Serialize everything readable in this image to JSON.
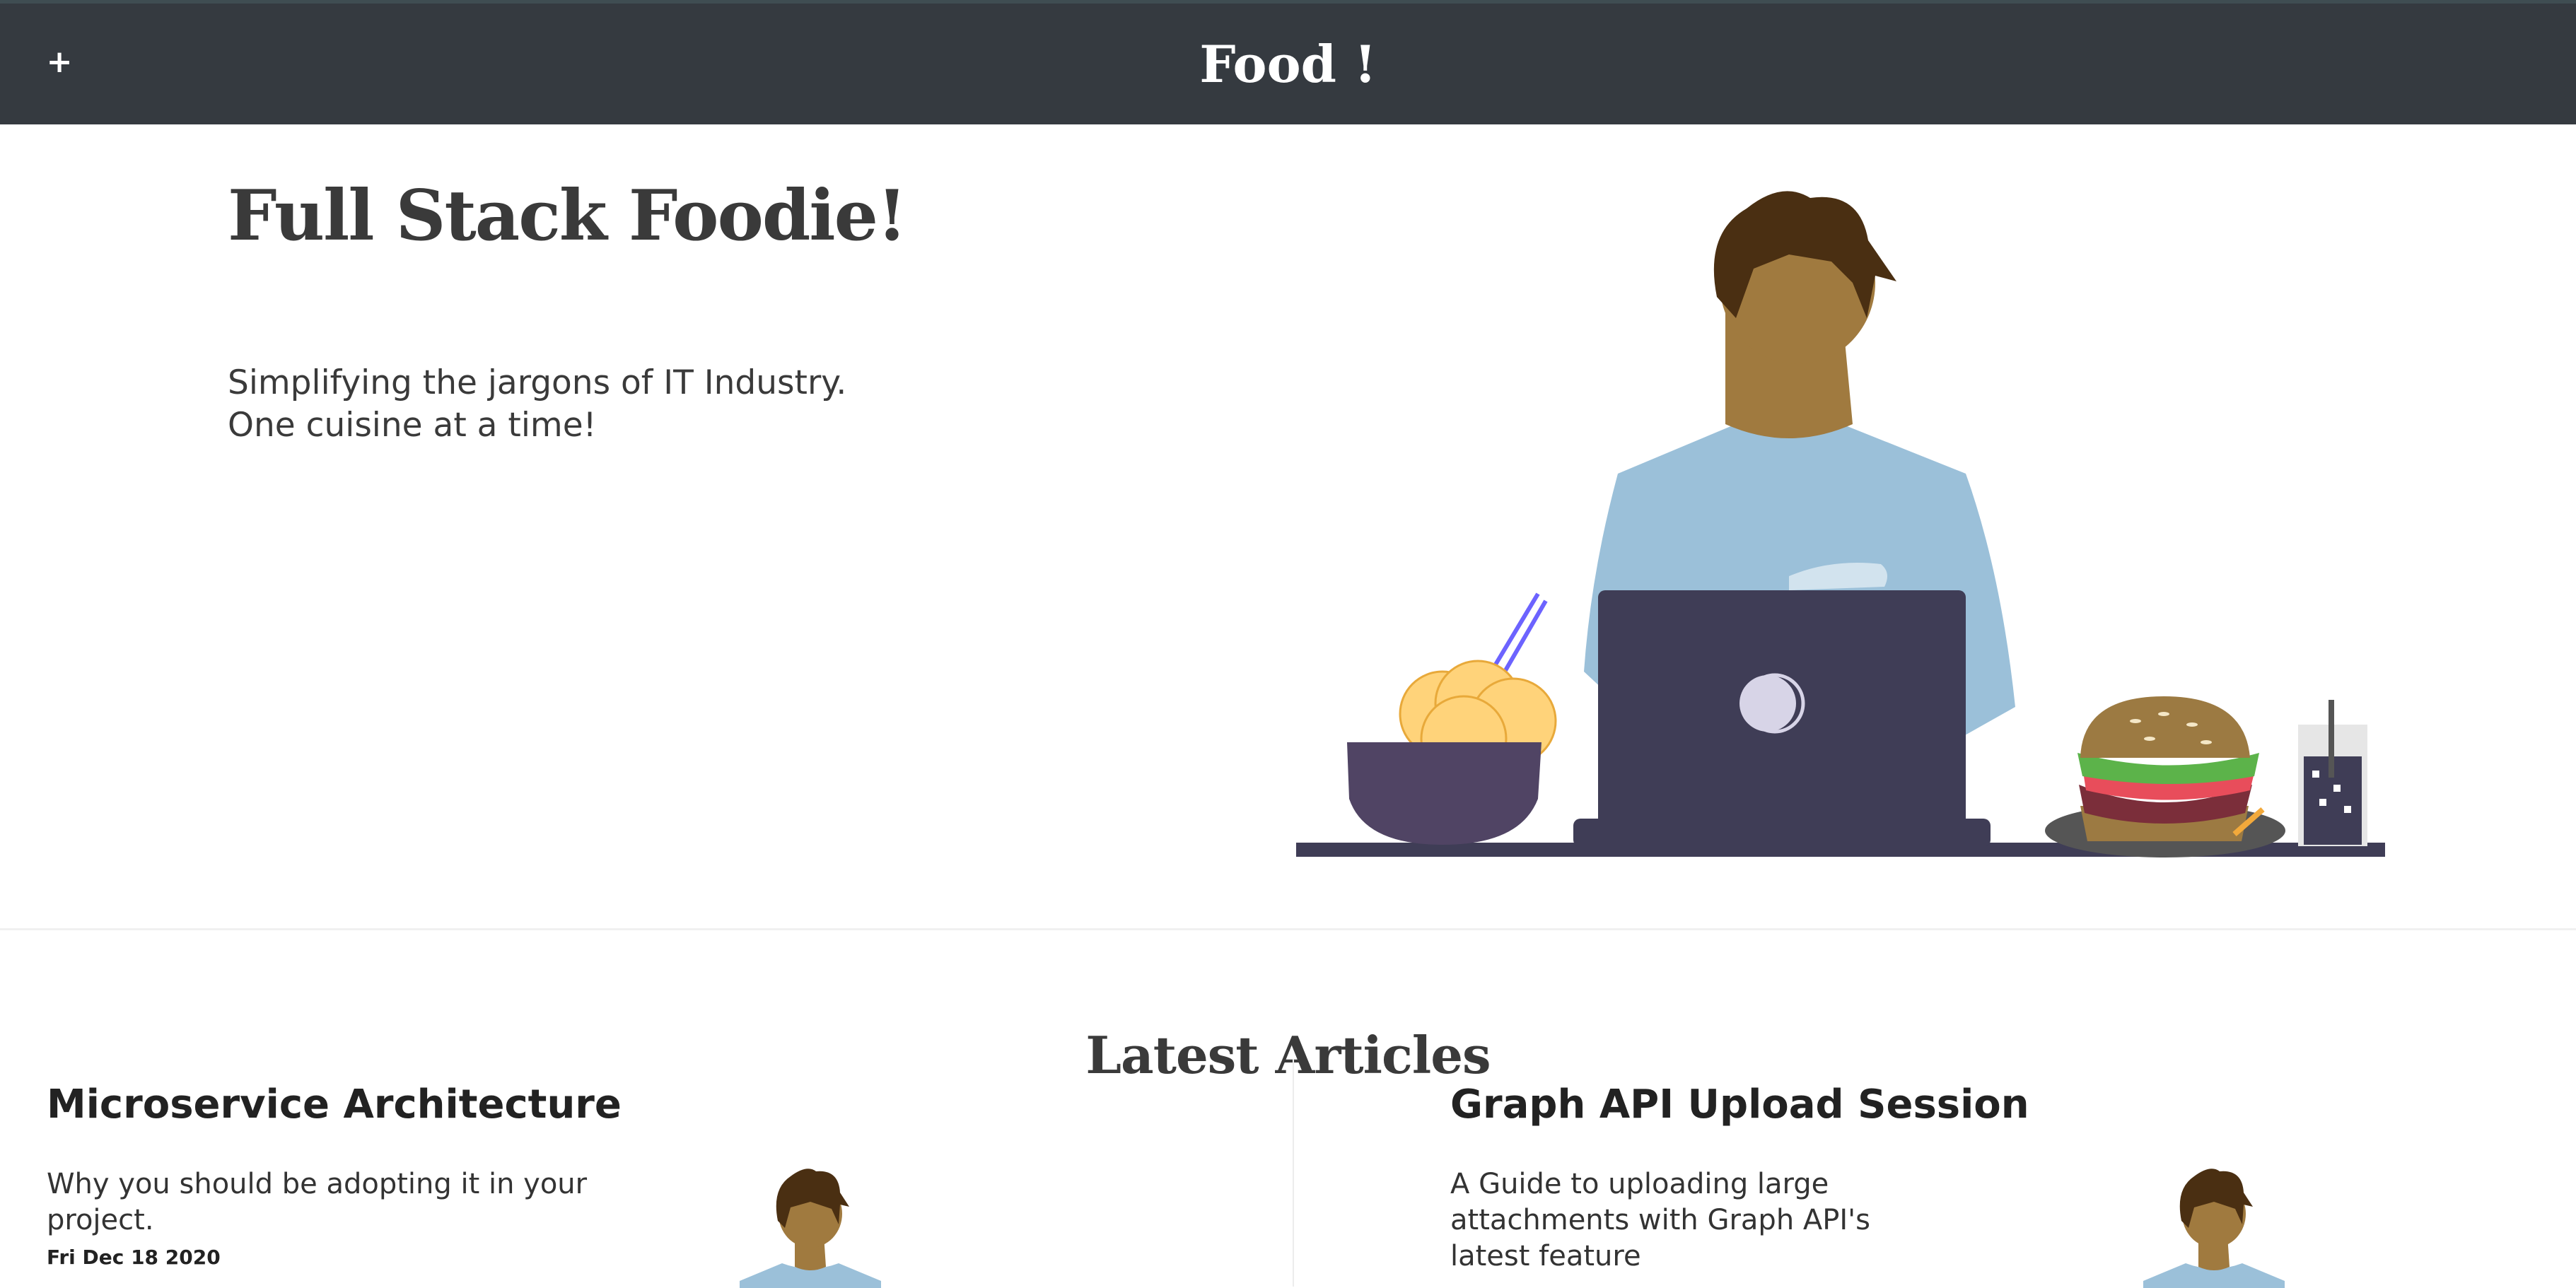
{
  "header": {
    "menu_icon": "plus-icon",
    "menu_glyph": "+",
    "brand": "Food !"
  },
  "hero": {
    "title": "Full Stack Foodie!",
    "subtitle_line1": "Simplifying the jargons of IT Industry.",
    "subtitle_line2": "One cuisine at a time!"
  },
  "articles": {
    "section_title": "Latest Articles",
    "items": [
      {
        "title": "Microservice Architecture",
        "description": "Why you should be adopting it in your project.",
        "date": "Fri Dec 18 2020"
      },
      {
        "title": "Graph API Upload Session",
        "description": "A Guide to uploading large attachments with Graph API's latest feature",
        "date": ""
      }
    ]
  },
  "colors": {
    "topbar": "#353a40",
    "text": "#3a3a3a",
    "shirt": "#9bc0d9",
    "skin": "#a07a3f",
    "hair": "#4a2f12",
    "laptop": "#3f3d56"
  }
}
